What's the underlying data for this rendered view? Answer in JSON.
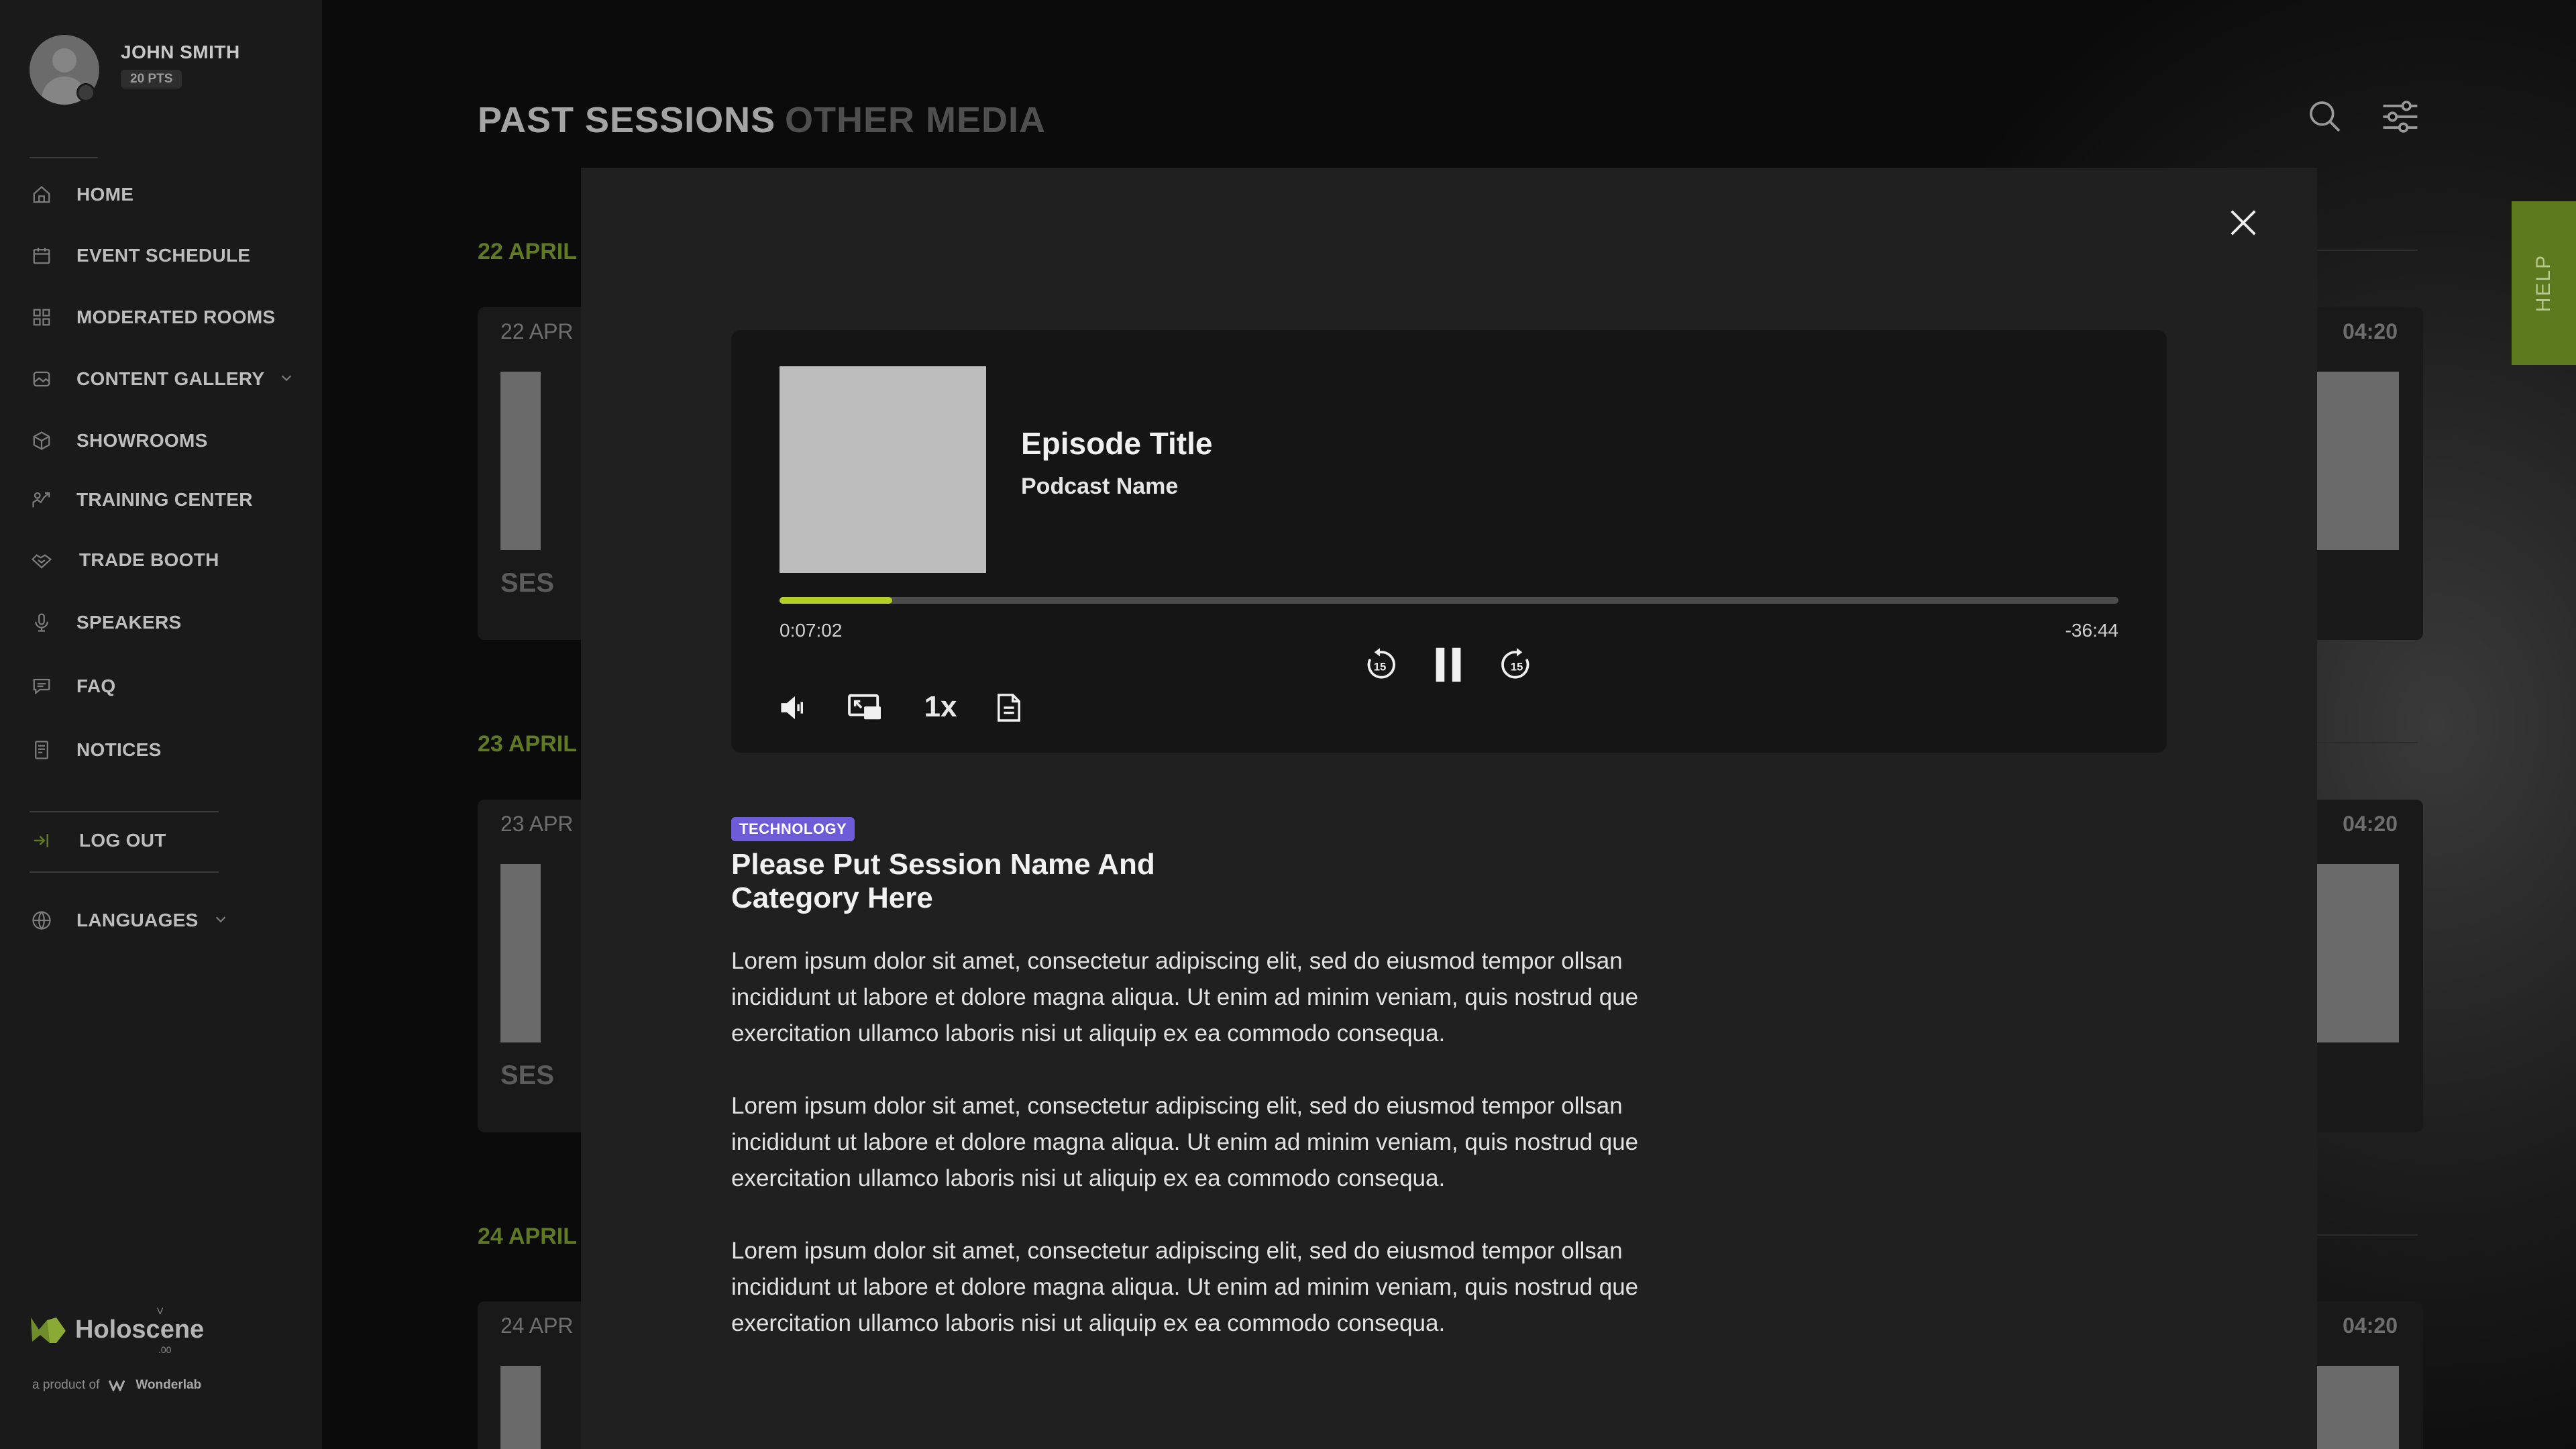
{
  "user": {
    "name": "JOHN SMITH",
    "points": "20 PTS"
  },
  "sidebar": {
    "items": [
      {
        "label": "HOME",
        "icon": "home-icon"
      },
      {
        "label": "EVENT SCHEDULE",
        "icon": "calendar-icon"
      },
      {
        "label": "MODERATED ROOMS",
        "icon": "grid-icon"
      },
      {
        "label": "CONTENT GALLERY",
        "icon": "gallery-icon",
        "expandable": true
      },
      {
        "label": "SHOWROOMS",
        "icon": "cube-icon"
      },
      {
        "label": "TRAINING CENTER",
        "icon": "training-icon"
      },
      {
        "label": "TRADE BOOTH",
        "icon": "handshake-icon"
      },
      {
        "label": "SPEAKERS",
        "icon": "microphone-icon"
      },
      {
        "label": "FAQ",
        "icon": "chat-icon"
      },
      {
        "label": "NOTICES",
        "icon": "document-icon"
      }
    ],
    "logout_label": "LOG OUT",
    "languages_label": "LANGUAGES"
  },
  "brand": {
    "name": "Holoscene",
    "version": "V",
    "sub_version": ".00",
    "byline": "a product of",
    "maker": "Wonderlab"
  },
  "tabs": [
    {
      "label": "PAST SESSIONS",
      "active": true
    },
    {
      "label": "OTHER MEDIA",
      "active": false
    }
  ],
  "help_label": "HELP",
  "sessions": [
    {
      "heading": "22 APRIL",
      "card_date": "22 APR",
      "title": "SESSION TWO LINES",
      "duration": "04:20"
    },
    {
      "heading": "23 APRIL",
      "card_date": "23 APR",
      "title": "SESSION TWO LINES",
      "duration": "04:20"
    },
    {
      "heading": "24 APRIL",
      "card_date": "24 APR",
      "duration": "04:20"
    }
  ],
  "player": {
    "episode_title": "Episode Title",
    "podcast_name": "Podcast Name",
    "elapsed": "0:07:02",
    "remaining": "-36:44",
    "progress": 0.084,
    "speed": "1x",
    "skip_back_seconds": "15",
    "skip_forward_seconds": "15"
  },
  "session_detail": {
    "category": "TECHNOLOGY",
    "name": "Please Put Session Name And Category Here",
    "paragraphs": [
      "Lorem ipsum dolor sit amet, consectetur adipiscing elit, sed do eiusmod tempor ollsan incididunt ut labore et dolore magna aliqua. Ut enim ad minim veniam, quis nostrud que exercitation ullamco laboris nisi ut aliquip ex ea commodo consequa.",
      "Lorem ipsum dolor sit amet, consectetur adipiscing elit, sed do eiusmod tempor ollsan incididunt ut labore et dolore magna aliqua. Ut enim ad minim veniam, quis nostrud  que exercitation ullamco laboris nisi ut aliquip ex ea commodo consequa.",
      "Lorem ipsum dolor sit amet, consectetur adipiscing elit, sed do eiusmod tempor ollsan incididunt ut labore et dolore magna aliqua. Ut enim ad minim veniam, quis nostrud que exercitation ullamco laboris nisi ut aliquip ex ea commodo consequa."
    ]
  },
  "colors": {
    "accent_green": "#b3cf26",
    "heading_green": "#5f7a22",
    "tag_purple": "#6e5bd8",
    "help_bg": "#5d7a1e"
  }
}
